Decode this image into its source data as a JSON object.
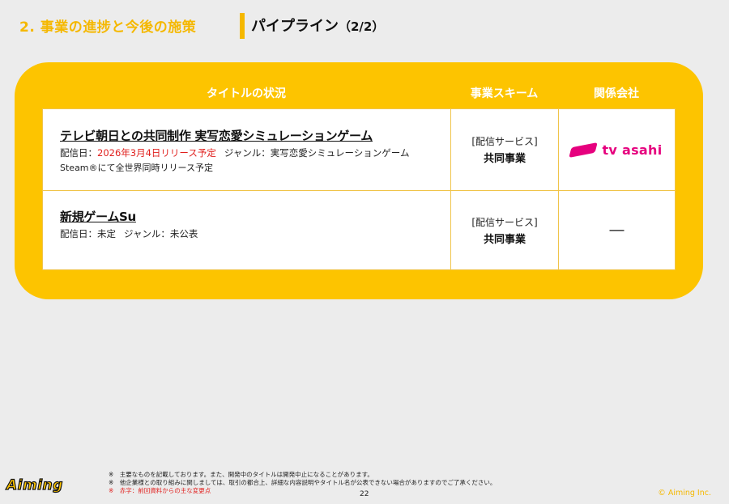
{
  "header": {
    "section_title": "2. 事業の進捗と今後の施策",
    "page_title": "パイプライン",
    "page_title_sub": "（2/2）"
  },
  "table": {
    "headers": {
      "title": "タイトルの状況",
      "scheme": "事業スキーム",
      "company": "関係会社"
    },
    "rows": [
      {
        "name": "テレビ朝日との共同制作 実写恋愛シミュレーションゲーム",
        "release_label": "配信日：",
        "release_value": "2026年3月4日リリース予定",
        "genre": "ジャンル：実写恋愛シミュレーションゲーム",
        "note": "Steam®にて全世界同時リリース予定",
        "scheme_type": "[配信サービス]",
        "scheme_value": "共同事業",
        "company_logo_text": "tv asahi"
      },
      {
        "name": "新規ゲームSu",
        "release_label": "配信日：",
        "release_value": "未定",
        "genre": "ジャンル：未公表",
        "scheme_type": "[配信サービス]",
        "scheme_value": "共同事業",
        "company": "―"
      }
    ]
  },
  "footer": {
    "notes": [
      "※　主要なものを記載しております。また、開発中のタイトルは開発中止になることがあります。",
      "※　他企業様との取り組みに関しましては、取引の都合上、詳細な内容説明やタイトル名が公表できない場合がありますのでご了承ください。",
      "※　赤字：前回資料からの主な変更点"
    ],
    "page_number": "22",
    "copyright": "© Aiming Inc.",
    "logo_text": "Aiming"
  },
  "colors": {
    "accent": "#fdc400",
    "red": "#e0201e",
    "tv_asahi": "#e6007e"
  }
}
